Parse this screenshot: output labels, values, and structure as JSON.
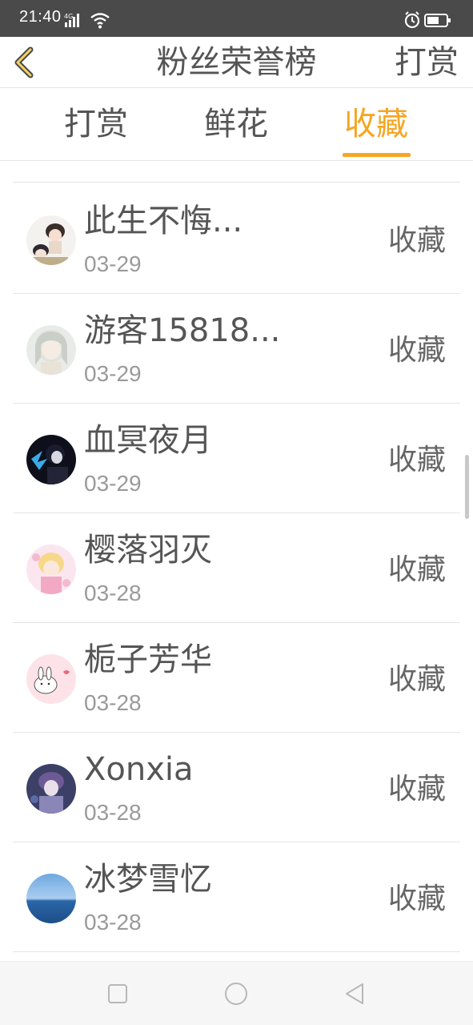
{
  "status_bar": {
    "time": "21:40",
    "network": "4G",
    "icons": [
      "signal-icon",
      "wifi-icon",
      "alarm-icon",
      "battery-icon"
    ]
  },
  "header": {
    "back_icon": "chevron-left-icon",
    "title": "粉丝荣誉榜",
    "action_label": "打赏"
  },
  "tabs": [
    {
      "label": "打赏",
      "active": false
    },
    {
      "label": "鲜花",
      "active": false
    },
    {
      "label": "收藏",
      "active": true
    }
  ],
  "colors": {
    "accent": "#f5a623",
    "text": "#555555",
    "subtext": "#9a9a9a",
    "divider": "#e6e6e6",
    "status_bar": "#4a4a4a"
  },
  "rows": [
    {
      "name": "此生不悔...",
      "date": "03-29",
      "action": "收藏",
      "avatar": "anime-couple-avatar"
    },
    {
      "name": "游客15818...",
      "date": "03-29",
      "action": "收藏",
      "avatar": "anime-girl-avatar"
    },
    {
      "name": "血冥夜月",
      "date": "03-29",
      "action": "收藏",
      "avatar": "dark-figure-avatar"
    },
    {
      "name": "樱落羽灭",
      "date": "03-28",
      "action": "收藏",
      "avatar": "pink-anime-avatar"
    },
    {
      "name": "栀子芳华",
      "date": "03-28",
      "action": "收藏",
      "avatar": "bunny-avatar"
    },
    {
      "name": "Xonxia",
      "date": "03-28",
      "action": "收藏",
      "avatar": "purple-anime-avatar"
    },
    {
      "name": "冰梦雪忆",
      "date": "03-28",
      "action": "收藏",
      "avatar": "ocean-avatar"
    }
  ],
  "navbar": {
    "icons": [
      "recent-apps-icon",
      "home-icon",
      "back-icon"
    ]
  }
}
